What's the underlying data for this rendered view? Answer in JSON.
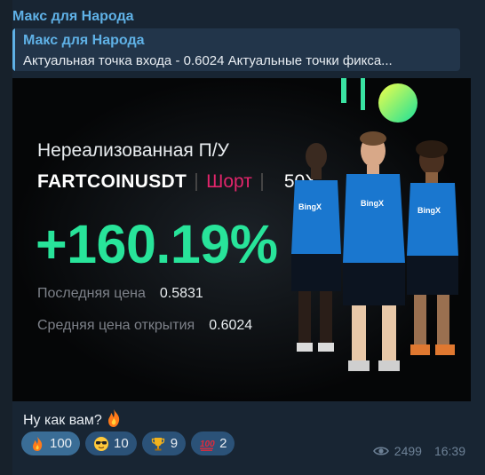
{
  "message": {
    "sender": "Макс для Народа",
    "reply": {
      "name": "Макс для Народа",
      "text": "Актуальная точка входа - 0.6024   Актуальные точки фикса..."
    },
    "caption": "Ну как вам?",
    "caption_emoji": "fire-icon",
    "views": "2499",
    "time": "16:39"
  },
  "card": {
    "title": "Нереализованная П/У",
    "symbol": "FARTCOINUSDT",
    "side": "Шорт",
    "leverage": "50X",
    "pnl": "+160.19%",
    "last_price_label": "Последняя цена",
    "last_price": "0.5831",
    "avg_open_label": "Средняя цена открытия",
    "avg_open": "0.6024",
    "jersey_brand": "BingX",
    "colors": {
      "pnl": "#28e49a",
      "short": "#e2256b",
      "jersey": "#1a77cf"
    }
  },
  "reactions": [
    {
      "emoji": "fire-icon",
      "count": "100",
      "active": true
    },
    {
      "emoji": "sunglasses-face-icon",
      "count": "10",
      "active": false
    },
    {
      "emoji": "trophy-icon",
      "count": "9",
      "active": false
    },
    {
      "emoji": "hundred-points-icon",
      "count": "2",
      "active": false
    }
  ]
}
